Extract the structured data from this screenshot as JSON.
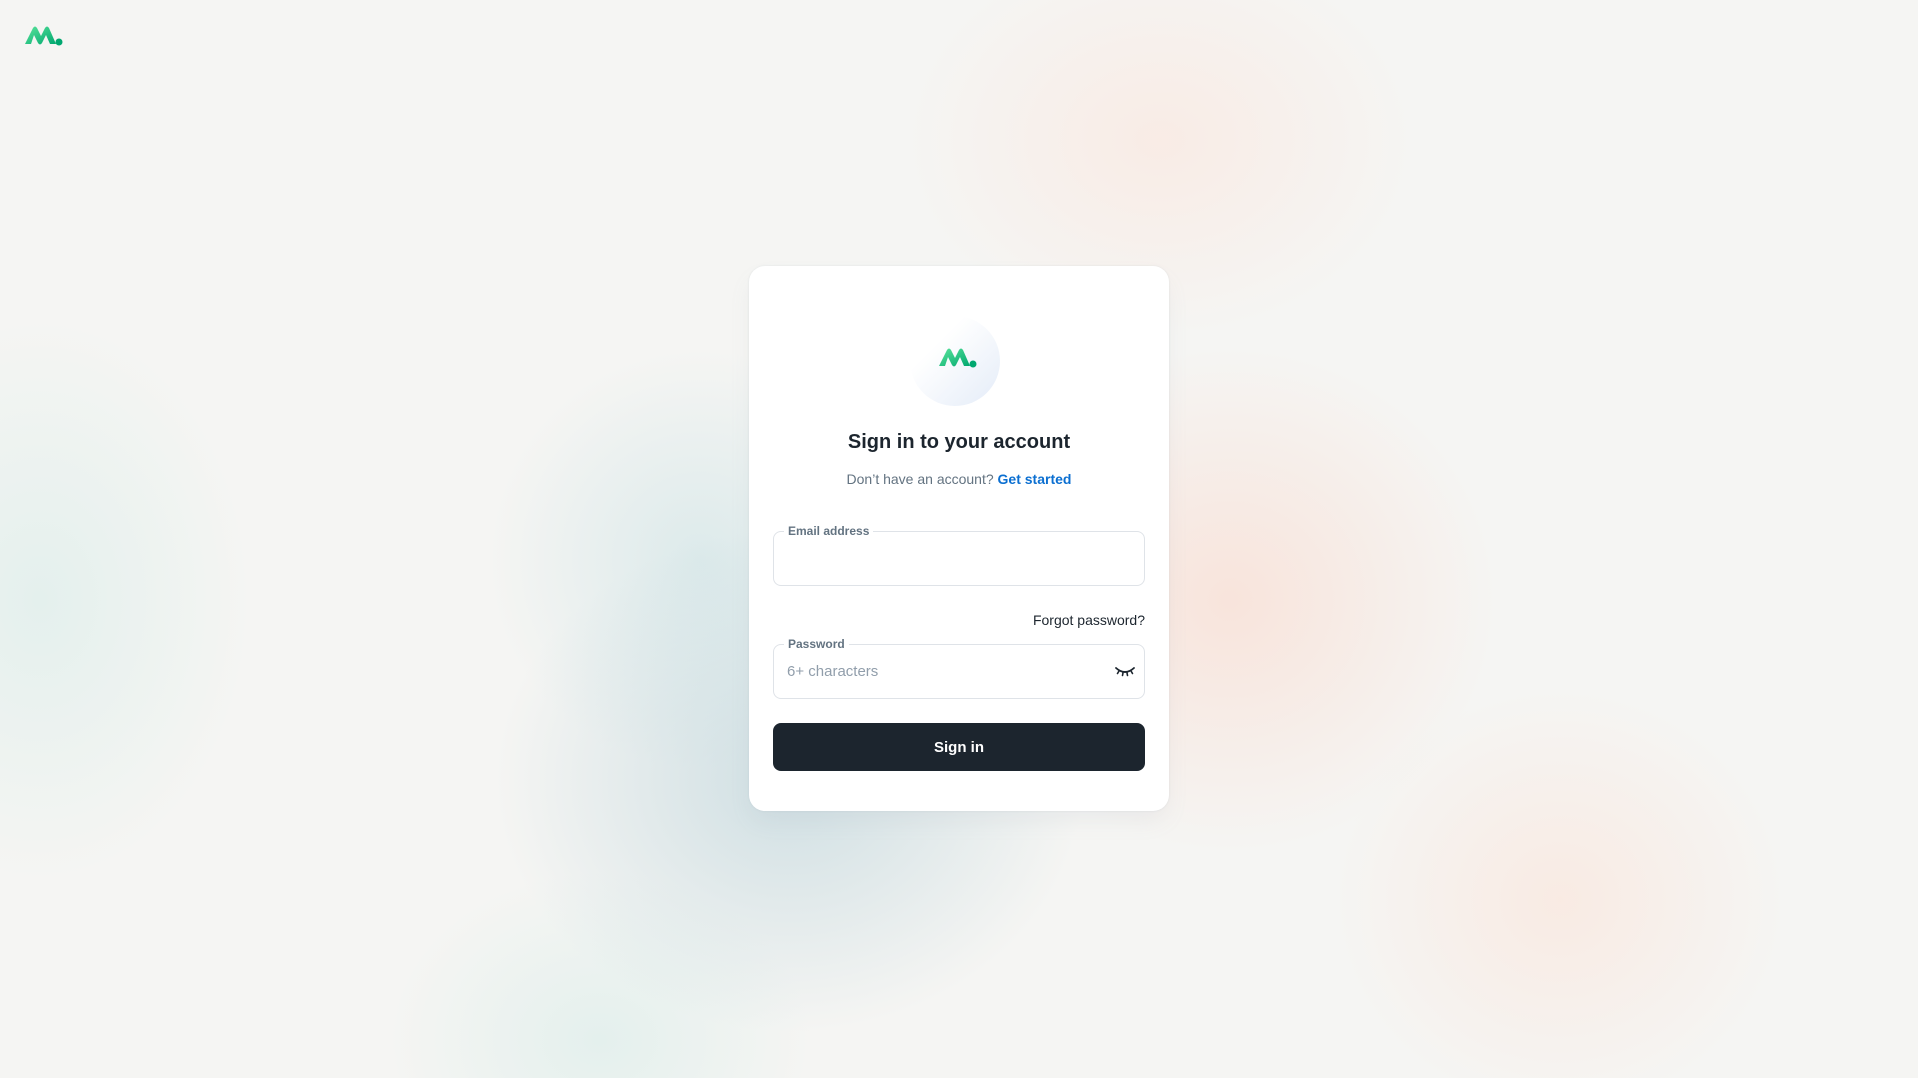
{
  "brand": {
    "logo_icon": "minimal-logo-icon",
    "colors": {
      "green_dark": "#00a76f",
      "green_light": "#5be49b"
    }
  },
  "card": {
    "title": "Sign in to your account",
    "subtitle_text": "Don’t have an account?",
    "get_started_label": "Get started",
    "email": {
      "label": "Email address",
      "value": "",
      "placeholder": ""
    },
    "forgot_password_label": "Forgot password?",
    "password": {
      "label": "Password",
      "value": "",
      "placeholder": "6+ characters",
      "toggle_icon": "eye-closed-icon"
    },
    "signin_label": "Sign in"
  },
  "colors": {
    "primary_dark": "#1c252e",
    "link": "#0b6fd1",
    "muted": "#637381"
  }
}
